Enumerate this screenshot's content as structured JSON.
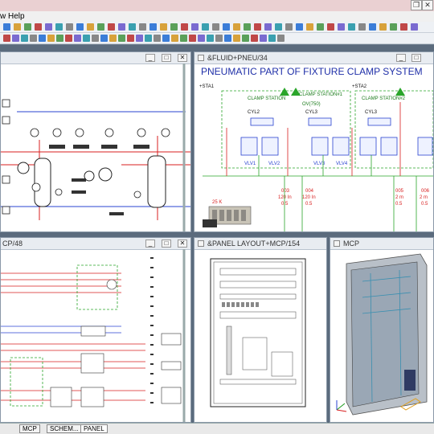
{
  "menu": {
    "view_partial": "w",
    "help": "Help"
  },
  "windows": {
    "pid": {
      "title": ""
    },
    "pneumatic": {
      "title": "&FLUID+PNEU/34",
      "heading": "PNEUMATIC PART OF FIXTURE CLAMP SYSTEM",
      "sta1": "+STA1",
      "sta2": "+STA2",
      "clamp_station": "CLAMP STATION",
      "cyl2": "CYL2",
      "clamp_station1": "CLAMP STATION#1",
      "ov": "OV(750)",
      "cyl3": "CYL3",
      "clamp_station2": "CLAMP STATION#2",
      "cyl3b": "CYL3",
      "vlv1": "VLV1",
      "vlv2": "VLV2",
      "vlv3": "VLV3",
      "vlv4": "VLV4",
      "w003": "003",
      "w003_len": "120 In",
      "w003_sz": "0.5",
      "w004": "004",
      "w004_len": "120 In",
      "w004_sz": "0.5",
      "w005": "005",
      "w005_len": "2 m",
      "w005_sz": "0.5",
      "w006": "006",
      "w006_len": "2 m",
      "w006_sz": "0.5",
      "press": "25 K"
    },
    "schematic": {
      "title": "CP/48"
    },
    "panel": {
      "title": "&PANEL LAYOUT+MCP/154"
    },
    "mcp": {
      "title": "MCP"
    }
  },
  "tabs": [
    "MCP",
    "SCHEM...",
    "PANEL"
  ],
  "colors": {
    "heading": "#1f2fa8",
    "wire_red": "#d81f1f",
    "wire_green": "#2aa52a",
    "wire_blue": "#2a43d0"
  }
}
